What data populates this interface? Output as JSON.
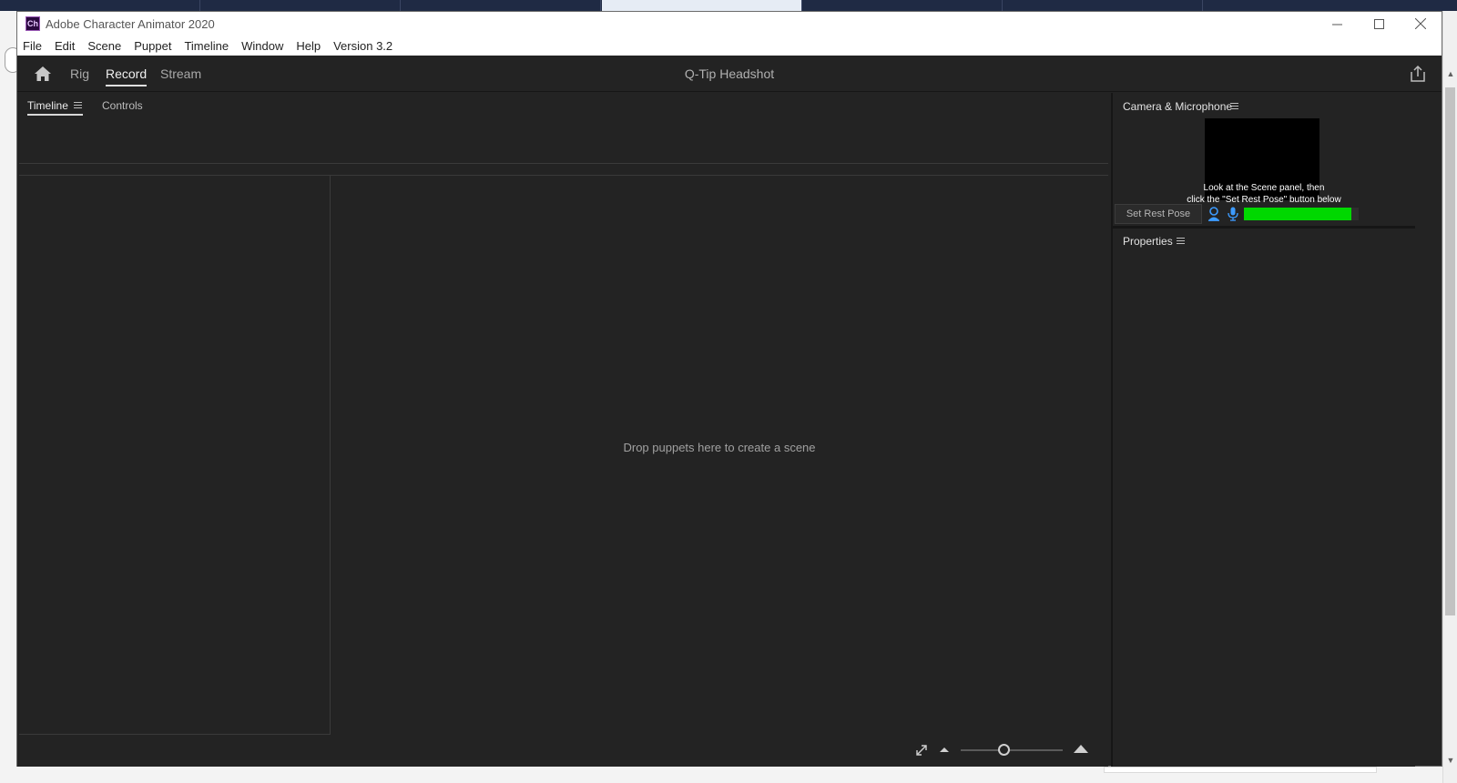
{
  "window": {
    "app_icon_text": "Ch",
    "title": "Adobe Character Animator 2020",
    "minimize": "—",
    "maximize": "☐",
    "close": "✕"
  },
  "menubar": {
    "items": [
      "File",
      "Edit",
      "Scene",
      "Puppet",
      "Timeline",
      "Window",
      "Help",
      "Version 3.2"
    ]
  },
  "header": {
    "tabs": [
      {
        "label": "Rig",
        "active": false
      },
      {
        "label": "Record",
        "active": true
      },
      {
        "label": "Stream",
        "active": false
      }
    ],
    "document_title": "Q-Tip Headshot"
  },
  "timeline_panel": {
    "tabs": [
      {
        "label": "Timeline",
        "active": true
      },
      {
        "label": "Controls",
        "active": false
      }
    ]
  },
  "scene": {
    "placeholder": "Drop puppets here to create a scene"
  },
  "camera_panel": {
    "title": "Camera & Microphone",
    "hint_line1": "Look at the Scene panel, then",
    "hint_line2": "click the \"Set Rest Pose\" button below",
    "set_rest_pose_label": "Set Rest Pose",
    "audio_level": 0.94,
    "level_color": "#00d800"
  },
  "properties_panel": {
    "title": "Properties"
  },
  "zoom": {
    "level": 0.42
  },
  "colors": {
    "background": "#232323",
    "active_text": "#f0f0f0",
    "inactive_text": "#a8a8a8"
  }
}
